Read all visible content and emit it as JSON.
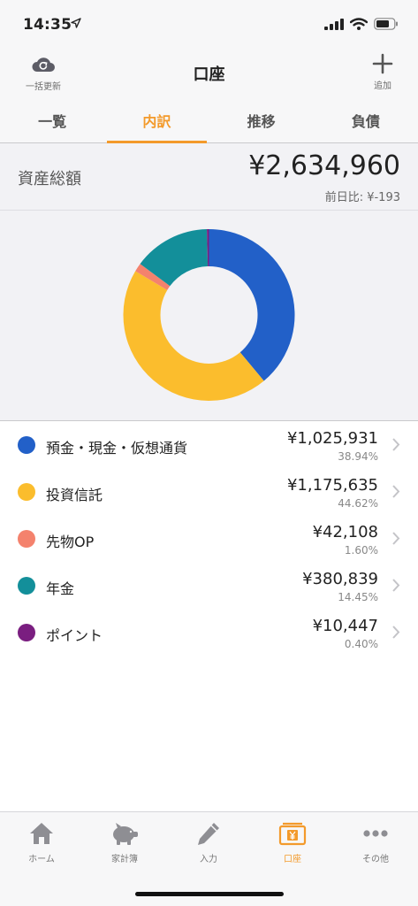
{
  "status": {
    "time": "14:35"
  },
  "header": {
    "refresh_label": "一括更新",
    "title": "口座",
    "add_label": "追加"
  },
  "tabs": [
    {
      "label": "一覧",
      "active": false
    },
    {
      "label": "内訳",
      "active": true
    },
    {
      "label": "推移",
      "active": false
    },
    {
      "label": "負債",
      "active": false
    }
  ],
  "summary": {
    "label": "資産総額",
    "amount": "¥2,634,960",
    "diff": "前日比: ¥-193"
  },
  "chart_data": {
    "type": "pie",
    "donut": true,
    "slices": [
      {
        "name": "預金・現金・仮想通貨",
        "value": 1025931,
        "percent": 38.94,
        "color": "#2260c8"
      },
      {
        "name": "投資信託",
        "value": 1175635,
        "percent": 44.62,
        "color": "#fbbd2d"
      },
      {
        "name": "先物OP",
        "value": 42108,
        "percent": 1.6,
        "color": "#f4826d"
      },
      {
        "name": "年金",
        "value": 380839,
        "percent": 14.45,
        "color": "#138f9a"
      },
      {
        "name": "ポイント",
        "value": 10447,
        "percent": 0.4,
        "color": "#7a1e80"
      }
    ]
  },
  "assets": [
    {
      "label": "預金・現金・仮想通貨",
      "amount": "¥1,025,931",
      "percent": "38.94%",
      "color": "#2260c8"
    },
    {
      "label": "投資信託",
      "amount": "¥1,175,635",
      "percent": "44.62%",
      "color": "#fbbd2d"
    },
    {
      "label": "先物OP",
      "amount": "¥42,108",
      "percent": "1.60%",
      "color": "#f4826d"
    },
    {
      "label": "年金",
      "amount": "¥380,839",
      "percent": "14.45%",
      "color": "#138f9a"
    },
    {
      "label": "ポイント",
      "amount": "¥10,447",
      "percent": "0.40%",
      "color": "#7a1e80"
    }
  ],
  "tabbar": [
    {
      "label": "ホーム",
      "icon": "home-icon",
      "active": false
    },
    {
      "label": "家計簿",
      "icon": "piggy-bank-icon",
      "active": false
    },
    {
      "label": "入力",
      "icon": "pencil-icon",
      "active": false
    },
    {
      "label": "口座",
      "icon": "wallet-icon",
      "active": true
    },
    {
      "label": "その他",
      "icon": "more-icon",
      "active": false
    }
  ],
  "colors": {
    "accent": "#f39a2b"
  }
}
